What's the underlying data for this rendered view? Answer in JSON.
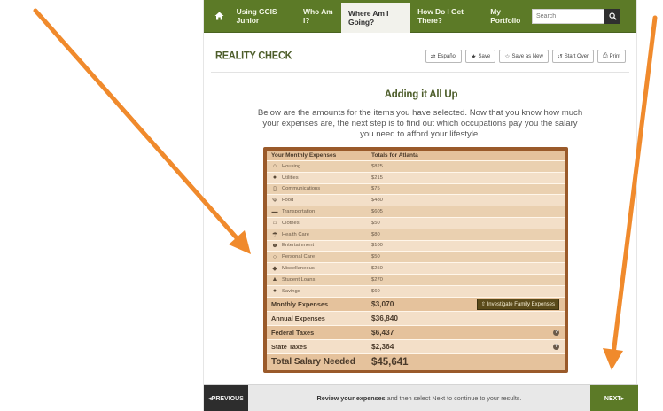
{
  "nav": {
    "items": [
      "Using GCIS Junior",
      "Who Am I?",
      "Where Am I Going?",
      "How Do I Get There?",
      "My Portfolio"
    ],
    "search_placeholder": "Search"
  },
  "header": {
    "title": "REALITY CHECK",
    "buttons": [
      "Español",
      "Save",
      "Save as New",
      "Start Over",
      "Print"
    ]
  },
  "section": {
    "title": "Adding it All Up",
    "intro": "Below are the amounts for the items you have selected. Now that you know how much your expenses are, the next step is to find out which occupations pay you the salary you need to afford your lifestyle."
  },
  "table": {
    "col1": "Your Monthly Expenses",
    "col2": "Totals for Atlanta",
    "rows": [
      {
        "label": "Housing",
        "value": "$825",
        "icon": "home-icon"
      },
      {
        "label": "Utilities",
        "value": "$215",
        "icon": "lightbulb-icon"
      },
      {
        "label": "Communications",
        "value": "$75",
        "icon": "phone-icon"
      },
      {
        "label": "Food",
        "value": "$480",
        "icon": "utensils-icon"
      },
      {
        "label": "Transportation",
        "value": "$605",
        "icon": "car-icon"
      },
      {
        "label": "Clothes",
        "value": "$50",
        "icon": "hanger-icon"
      },
      {
        "label": "Health Care",
        "value": "$80",
        "icon": "health-icon"
      },
      {
        "label": "Entertainment",
        "value": "$100",
        "icon": "mask-icon"
      },
      {
        "label": "Personal Care",
        "value": "$50",
        "icon": "personal-care-icon"
      },
      {
        "label": "Miscellaneous",
        "value": "$250",
        "icon": "tag-icon"
      },
      {
        "label": "Student Loans",
        "value": "$270",
        "icon": "graduation-cap-icon"
      },
      {
        "label": "Savings",
        "value": "$60",
        "icon": "piggy-bank-icon"
      }
    ],
    "monthly_label": "Monthly Expenses",
    "monthly_value": "$3,070",
    "investigate_label": "Investigate Family Expenses",
    "annual_label": "Annual Expenses",
    "annual_value": "$36,840",
    "federal_label": "Federal Taxes",
    "federal_value": "$6,437",
    "state_label": "State Taxes",
    "state_value": "$2,364",
    "total_label": "Total Salary Needed",
    "total_value": "$45,641"
  },
  "footer": {
    "previous": "PREVIOUS",
    "next": "NEXT",
    "msg_bold": "Review your expenses",
    "msg_rest": " and then select Next to continue to your results."
  },
  "colors": {
    "nav_green": "#5c7a27",
    "title_green": "#4d5d2a",
    "table_border": "#9a5a2a",
    "annotation_arrow": "#f08a2c"
  }
}
